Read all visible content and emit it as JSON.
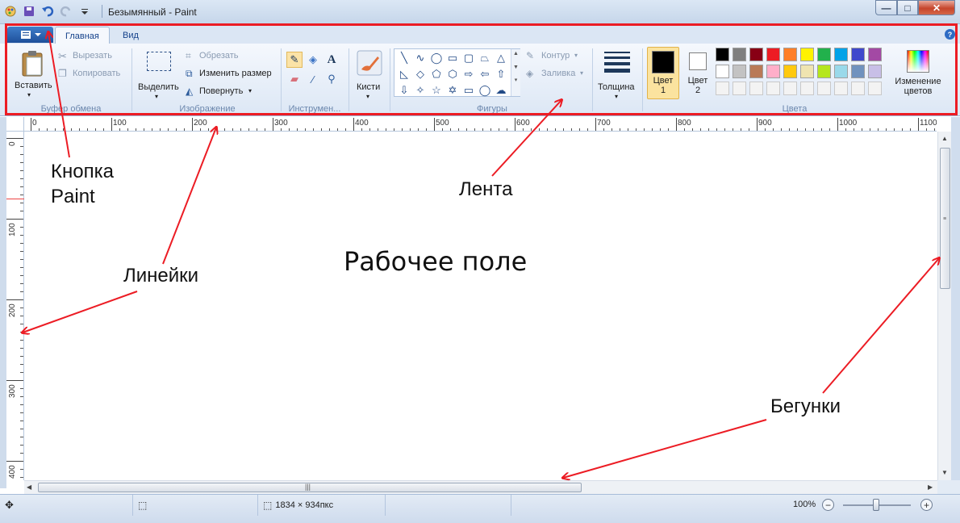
{
  "window": {
    "title": "Безымянный - Paint",
    "controls": {
      "minimize": "—",
      "maximize": "□",
      "close": "✕"
    }
  },
  "ribbon": {
    "tabs": [
      {
        "label": "Главная",
        "active": true
      },
      {
        "label": "Вид",
        "active": false
      }
    ],
    "help": "?",
    "clipboard": {
      "paste": "Вставить",
      "cut": "Вырезать",
      "copy": "Копировать",
      "title": "Буфер обмена"
    },
    "image": {
      "select": "Выделить",
      "crop": "Обрезать",
      "resize": "Изменить размер",
      "rotate": "Повернуть",
      "title": "Изображение"
    },
    "tools": {
      "title": "Инструмен..."
    },
    "brushes": {
      "label": "Кисти"
    },
    "shapes": {
      "outline": "Контур",
      "fill": "Заливка",
      "title": "Фигуры",
      "glyphs": [
        "╲",
        "∿",
        "◯",
        "▭",
        "▢",
        "⏢",
        "△",
        "◺",
        "◇",
        "⬠",
        "⬡",
        "⇨",
        "⇦",
        "⇧",
        "⇩",
        "✧",
        "☆",
        "✡",
        "▭",
        "◯",
        "☁"
      ]
    },
    "size": {
      "label": "Толщина"
    },
    "colors": {
      "color1_line1": "Цвет",
      "color1_line2": "1",
      "color2_line1": "Цвет",
      "color2_line2": "2",
      "edit_line1": "Изменение",
      "edit_line2": "цветов",
      "title": "Цвета",
      "color1_value": "#000000",
      "color2_value": "#ffffff",
      "palette_row1": [
        "#000000",
        "#7f7f7f",
        "#880015",
        "#ed1c24",
        "#ff7f27",
        "#fff200",
        "#22b14c",
        "#00a2e8",
        "#3f48cc",
        "#a349a4"
      ],
      "palette_row2": [
        "#ffffff",
        "#c3c3c3",
        "#b97a57",
        "#ffaec9",
        "#ffc90e",
        "#efe4b0",
        "#b5e61d",
        "#99d9ea",
        "#7092be",
        "#c8bfe7"
      ]
    }
  },
  "rulers": {
    "horizontal_ticks": [
      "0",
      "100",
      "200",
      "300",
      "400",
      "500",
      "600",
      "700",
      "800",
      "900",
      "1000",
      "1100"
    ],
    "vertical_ticks": [
      "0",
      "100",
      "200",
      "300",
      "400"
    ]
  },
  "status": {
    "image_size": "1834 × 934пкс",
    "zoom": "100%"
  },
  "annotations": {
    "paint_button_line1": "Кнопка",
    "paint_button_line2": "Paint",
    "ribbon": "Лента",
    "rulers": "Линейки",
    "canvas": "Рабочее поле",
    "scrollbars": "Бегунки",
    "highlight_color": "#ec1c24"
  }
}
